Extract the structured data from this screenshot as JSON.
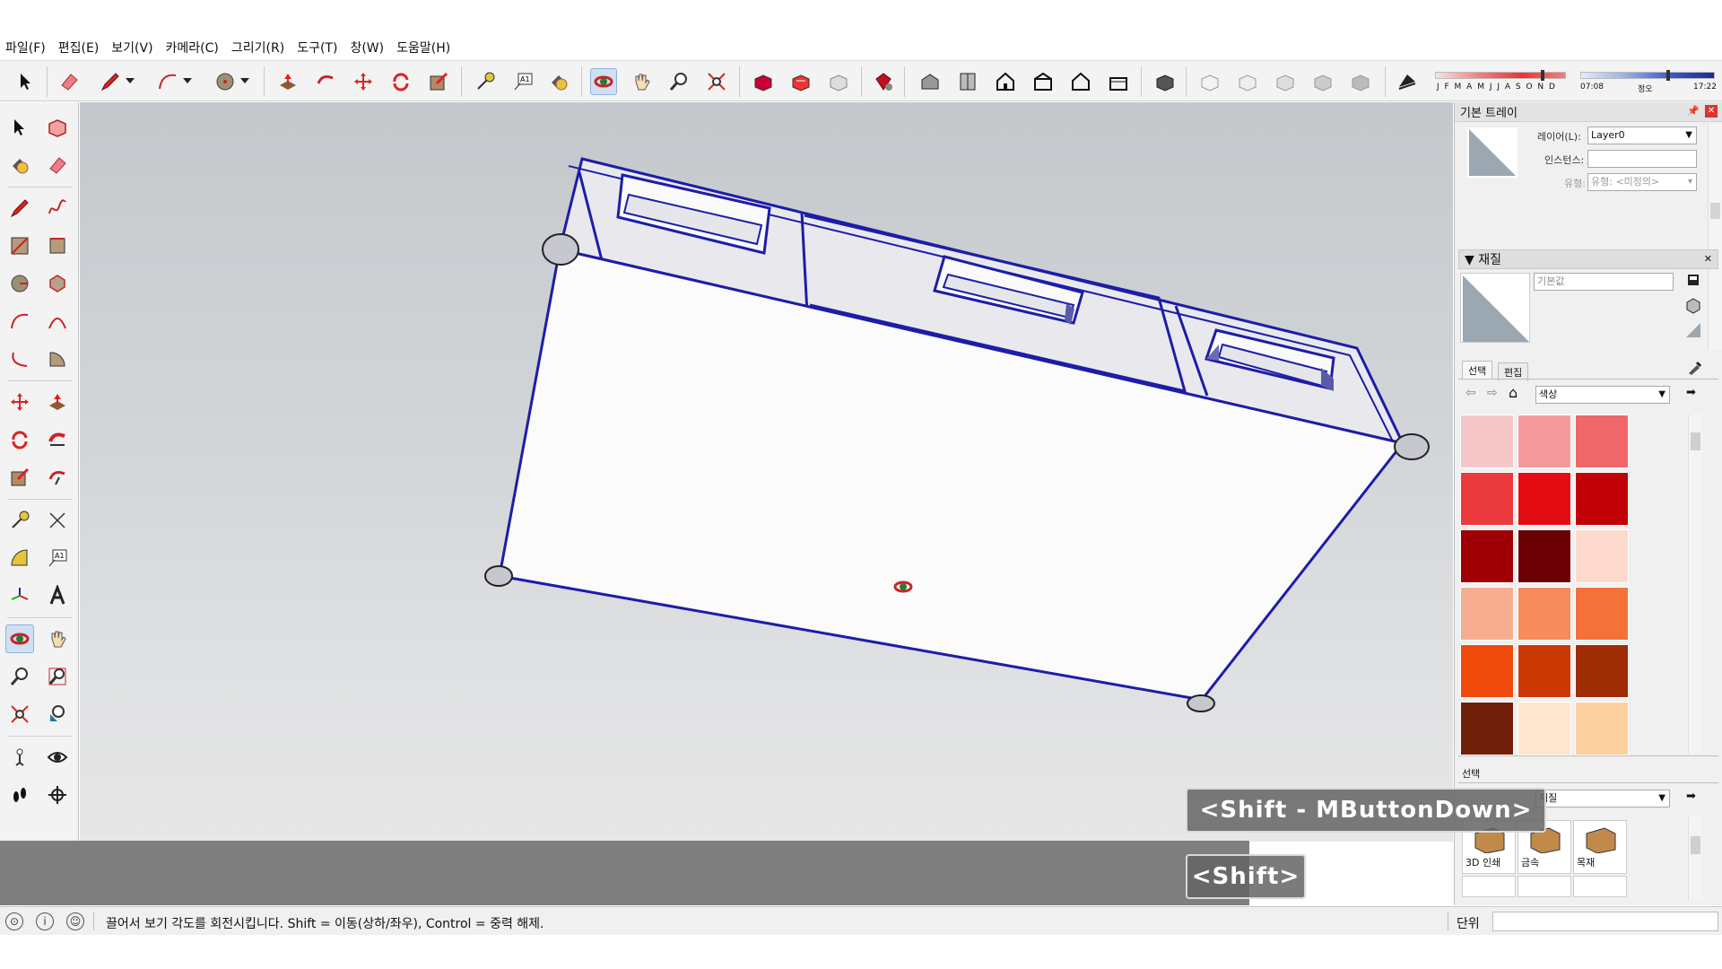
{
  "menu": {
    "items": [
      "파일(F)",
      "편집(E)",
      "보기(V)",
      "카메라(C)",
      "그리기(R)",
      "도구(T)",
      "창(W)",
      "도움말(H)"
    ]
  },
  "toolbar": {
    "shadow_months": "J F M A M J J A S O N D",
    "time_start": "07:08",
    "time_mid": "정오",
    "time_end": "17:22"
  },
  "tray": {
    "title": "기본 트레이",
    "entity_info": {
      "layer_label": "레이어(L):",
      "layer_value": "Layer0",
      "instance_label": "인스턴스:",
      "instance_value": "",
      "type_label": "유형:",
      "type_value": "유형: <미정의>"
    },
    "materials": {
      "header": "▼ 재질",
      "current_name": "기본값",
      "tabs": [
        "선택",
        "편집"
      ],
      "collection_select": "색상",
      "swatches": [
        "#f6c7c8",
        "#f49a9c",
        "#f0676a",
        "#ea3a3d",
        "#e30c12",
        "#c00006",
        "#9e0006",
        "#6a0004",
        "#fddacd",
        "#f7ad90",
        "#f68b5d",
        "#f4713a",
        "#ef4a0b",
        "#cb3a04",
        "#9e2d05",
        "#6f1f0a",
        "#fde6cd",
        "#fdd0a0"
      ],
      "bottom_label": "선택",
      "bottom_select": "재질",
      "material_tiles": [
        "3D 인쇄",
        "금속",
        "목재"
      ]
    }
  },
  "overlays": {
    "key1": "<Shift - MButtonDown>",
    "key2": "<Shift>"
  },
  "status": {
    "message": "끌어서 보기 각도를 회전시킵니다. Shift = 이동(상하/좌우), Control = 중력 해제.",
    "units_label": "단위"
  },
  "colors": {
    "selection_blue": "#1d1da8",
    "face": "#fbfbfb",
    "inner_face": "#e6e6ea",
    "accent_active": "#cfe0f3"
  }
}
